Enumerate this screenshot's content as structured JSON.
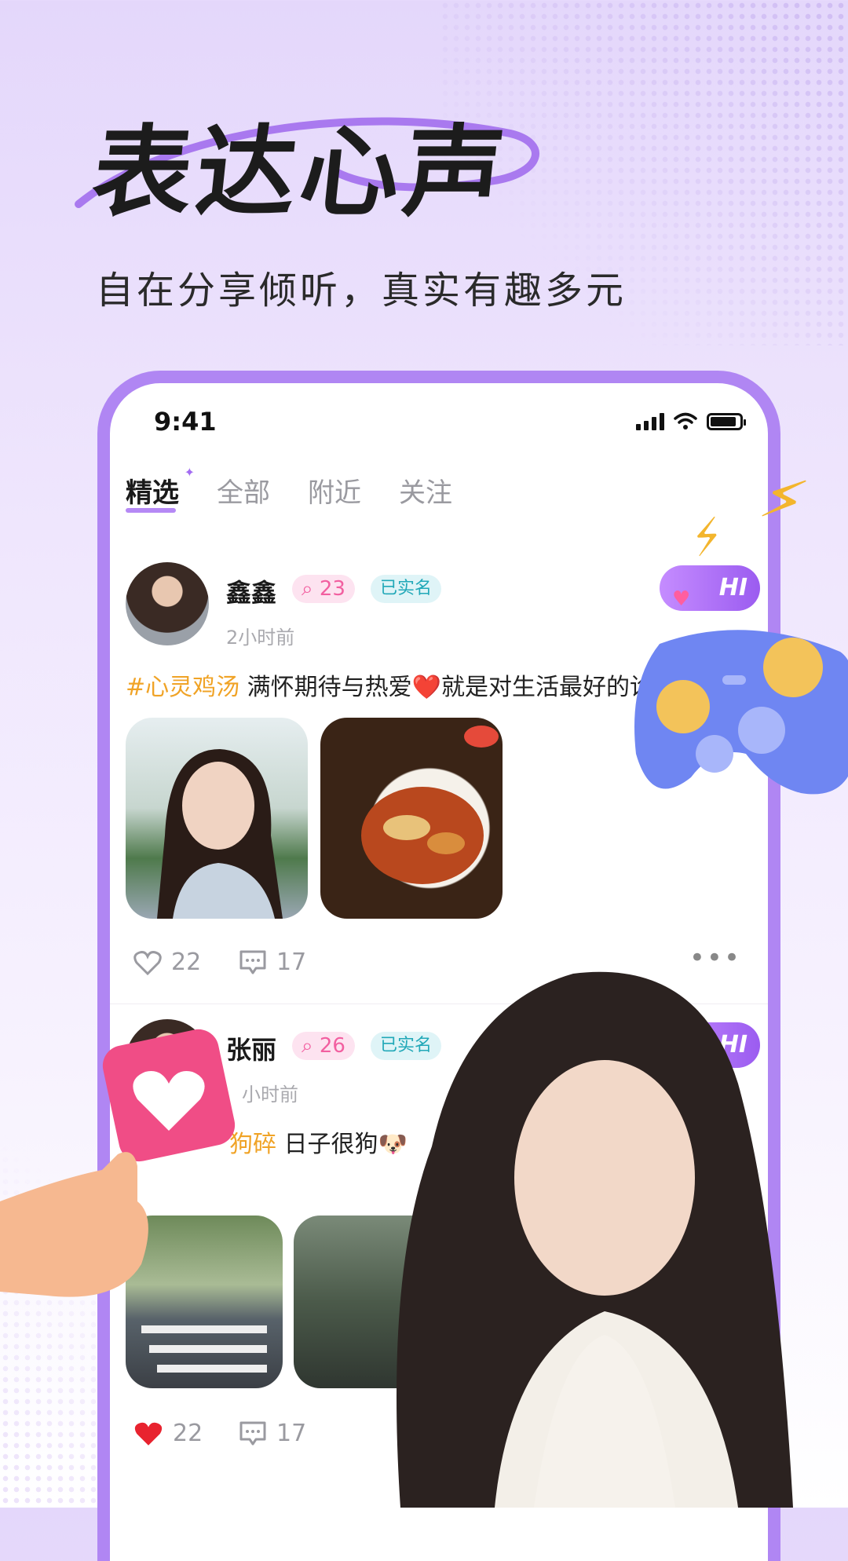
{
  "headline": "表达心声",
  "subheadline": "自在分享倾听，真实有趣多元",
  "status_bar": {
    "time": "9:41"
  },
  "tabs": [
    {
      "label": "精选",
      "active": true
    },
    {
      "label": "全部",
      "active": false
    },
    {
      "label": "附近",
      "active": false
    },
    {
      "label": "关注",
      "active": false
    }
  ],
  "posts": [
    {
      "username": "鑫鑫",
      "count_badge": "23",
      "verified_label": "已实名",
      "time_ago": "2小时前",
      "hashtag": "#心灵鸡汤",
      "text": " 满怀期待与热爱❤️就是对生活最好的诠",
      "likes": "22",
      "comments": "17",
      "hi_label": "HI"
    },
    {
      "username": "张丽",
      "count_badge": "26",
      "verified_label": "已实名",
      "time_ago": "小时前",
      "hashtag": "狗碎",
      "text": " 日子很狗🐶",
      "likes": "22",
      "comments": "17",
      "hi_label": "HI"
    }
  ],
  "colors": {
    "accent": "#a36cf2",
    "phone_frame": "#b086f3",
    "hashtag": "#f0a326",
    "badge_pink": "#f25fa0",
    "badge_teal": "#21a8b8"
  },
  "icons": [
    "signal-icon",
    "wifi-icon",
    "battery-icon",
    "heart-outline-icon",
    "comment-icon",
    "more-icon",
    "heart-filled-icon",
    "lightning-icon",
    "gamepad-icon",
    "heart-sign-icon",
    "hand-icon"
  ]
}
